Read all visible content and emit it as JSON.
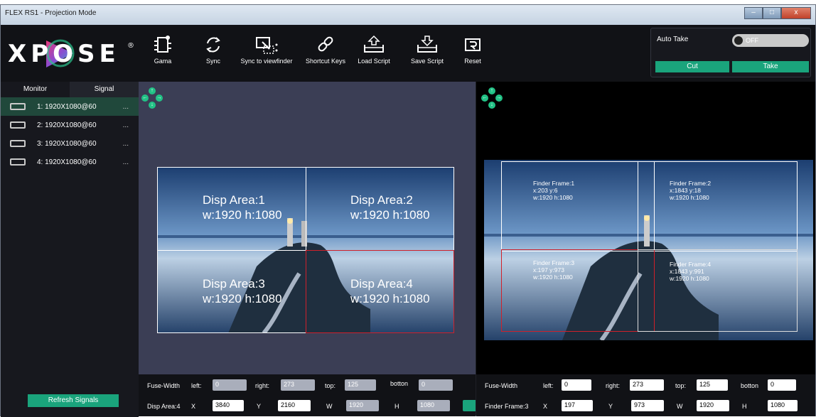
{
  "window": {
    "title": "FLEX RS1 - Projection Mode",
    "buttons": [
      "–",
      "□",
      "x"
    ]
  },
  "logo": {
    "text": "XPOSE",
    "mark": "®"
  },
  "toolbar": {
    "tools": [
      {
        "label": "Gama",
        "icon": "gamma-chip-icon"
      },
      {
        "label": "Sync",
        "icon": "sync-icon"
      },
      {
        "label": "Sync to viewfinder",
        "icon": "sync-viewfinder-icon"
      },
      {
        "label": "Shortcut Keys",
        "icon": "link-icon"
      },
      {
        "label": "Load Script",
        "icon": "load-script-icon"
      },
      {
        "label": "Save Script",
        "icon": "save-script-icon"
      },
      {
        "label": "Reset",
        "icon": "reset-icon"
      }
    ]
  },
  "auto_take": {
    "label": "Auto Take",
    "toggle": "OFF",
    "cut": "Cut",
    "take": "Take"
  },
  "sidebar": {
    "tabs": [
      "Monitor",
      "Signal"
    ],
    "signals": [
      {
        "label": "1: 1920X1080@60",
        "more": "..."
      },
      {
        "label": "2: 1920X1080@60",
        "more": "..."
      },
      {
        "label": "3: 1920X1080@60",
        "more": "..."
      },
      {
        "label": "4: 1920X1080@60",
        "more": "..."
      }
    ],
    "refresh": "Refresh Signals"
  },
  "arrows": {
    "up": "↑",
    "down": "↓",
    "left": "←",
    "right": "→"
  },
  "display_areas": [
    {
      "name": "Disp Area:1",
      "size": "w:1920  h:1080"
    },
    {
      "name": "Disp Area:2",
      "size": "w:1920  h:1080"
    },
    {
      "name": "Disp Area:3",
      "size": "w:1920  h:1080"
    },
    {
      "name": "Disp Area:4",
      "size": "w:1920  h:1080"
    }
  ],
  "finder_frames": [
    {
      "name": "Finder Frame:1",
      "pos": "x:203  y:6",
      "size": "w:1920  h:1080"
    },
    {
      "name": "Finder Frame:2",
      "pos": "x:1843  y:18",
      "size": "w:1920  h:1080"
    },
    {
      "name": "Finder Frame:3",
      "pos": "x:197  y:973",
      "size": "w:1920  h:1080"
    },
    {
      "name": "Finder Frame:4",
      "pos": "x:1843  y:991",
      "size": "w:1920  h:1080"
    }
  ],
  "left_bottom": {
    "fuse_width": "Fuse-Width",
    "left_label": "left:",
    "left": "0",
    "right_label": "right:",
    "right": "273",
    "top_label": "top:",
    "top": "125",
    "bottom_label": "botton",
    "bottom": "0",
    "area_label": "Disp Area:4",
    "x_label": "X",
    "x": "3840",
    "y_label": "Y",
    "y": "2160",
    "w_label": "W",
    "w": "1920",
    "h_label": "H",
    "h": "1080"
  },
  "right_bottom": {
    "fuse_width": "Fuse-Width",
    "left_label": "left:",
    "left": "0",
    "right_label": "right:",
    "right": "273",
    "top_label": "top:",
    "top": "125",
    "bottom_label": "botton",
    "bottom": "0",
    "frame_label": "Finder Frame:3",
    "x_label": "X",
    "x": "197",
    "y_label": "Y",
    "y": "973",
    "w_label": "W",
    "w": "1920",
    "h_label": "H",
    "h": "1080"
  },
  "colors": {
    "accent": "#1aa47c",
    "arrow": "#22c286",
    "selected_border": "#d0202a",
    "left_bg": "#3b3e55"
  }
}
